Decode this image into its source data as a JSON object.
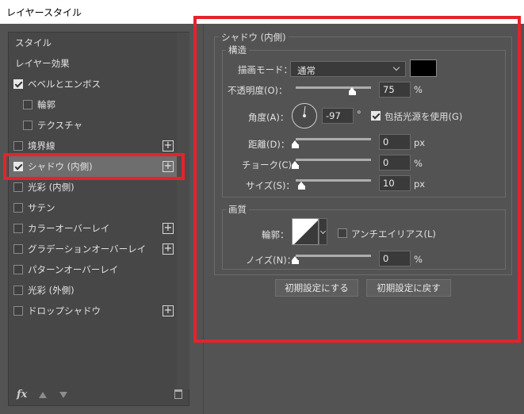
{
  "window": {
    "title": "レイヤースタイル"
  },
  "left_panel": {
    "items": [
      {
        "label": "スタイル",
        "kind": "header"
      },
      {
        "label": "レイヤー効果",
        "kind": "header"
      },
      {
        "label": "ベベルとエンボス",
        "checked": true,
        "plus": false
      },
      {
        "label": "輪郭",
        "checked": false,
        "sub": true
      },
      {
        "label": "テクスチャ",
        "checked": false,
        "sub": true
      },
      {
        "label": "境界線",
        "checked": false,
        "plus": true
      },
      {
        "label": "シャドウ (内側)",
        "checked": true,
        "plus": true,
        "selected": true
      },
      {
        "label": "光彩 (内側)",
        "checked": false
      },
      {
        "label": "サテン",
        "checked": false
      },
      {
        "label": "カラーオーバーレイ",
        "checked": false,
        "plus": true
      },
      {
        "label": "グラデーションオーバーレイ",
        "checked": false,
        "plus": true
      },
      {
        "label": "パターンオーバーレイ",
        "checked": false
      },
      {
        "label": "光彩 (外側)",
        "checked": false
      },
      {
        "label": "ドロップシャドウ",
        "checked": false,
        "plus": true
      }
    ],
    "footer": {
      "fx_label": "fx"
    }
  },
  "panel": {
    "section_title": "シャドウ (内側)",
    "structure": {
      "title": "構造",
      "blend_mode_label": "描画モード：",
      "blend_mode_value": "通常",
      "shadow_color": "#000000",
      "opacity_label": "不透明度(O)：",
      "opacity_value": "75",
      "opacity_unit": "%",
      "opacity_level": 0.75,
      "angle_label": "角度(A)：",
      "angle_value": "-97",
      "angle_unit": "°",
      "global_light_label": "包括光源を使用(G)",
      "global_light_checked": true,
      "distance_label": "距離(D)：",
      "distance_value": "0",
      "distance_unit": "px",
      "choke_label": "チョーク(C)：",
      "choke_value": "0",
      "choke_unit": "%",
      "size_label": "サイズ(S)：",
      "size_value": "10",
      "size_unit": "px"
    },
    "quality": {
      "title": "画質",
      "contour_label": "輪郭：",
      "antialias_label": "アンチエイリアス(L)",
      "antialias_checked": false,
      "noise_label": "ノイズ(N)：",
      "noise_value": "0",
      "noise_unit": "%"
    },
    "buttons": {
      "make_default": "初期設定にする",
      "reset_default": "初期設定に戻す"
    }
  },
  "colors": {
    "highlight_box": "#e5232b"
  }
}
